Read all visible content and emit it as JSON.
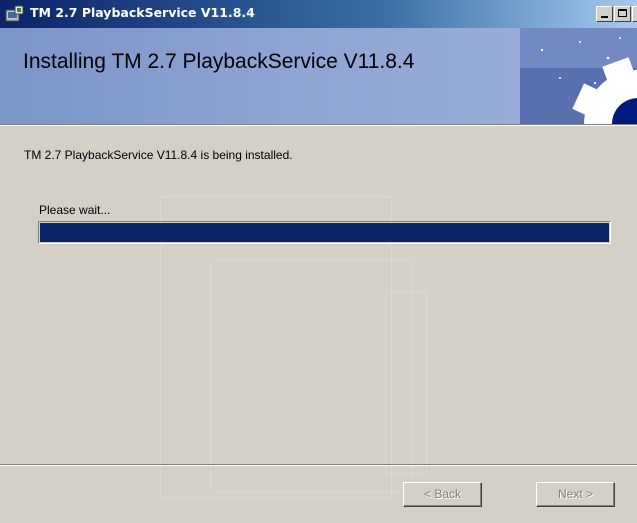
{
  "window": {
    "title": "TM 2.7 PlaybackService V11.8.4",
    "app_icon": "installer-icon",
    "controls": [
      "minimize-icon",
      "maximize-icon",
      "close-icon"
    ]
  },
  "banner": {
    "title": "Installing TM 2.7 PlaybackService V11.8.4",
    "art_icon": "gear-icon"
  },
  "body": {
    "status": "TM 2.7 PlaybackService V11.8.4 is being installed.",
    "wait_label": "Please wait...",
    "progress": 1.0
  },
  "buttons": {
    "back_label": "< Back",
    "next_label": "Next >",
    "back_enabled": false,
    "next_enabled": false
  },
  "colors": {
    "titlebar_start": "#0a246a",
    "banner": "#8ea4d2",
    "progress_fill": "#0a246a",
    "dialog_face": "#d4d0c8"
  }
}
